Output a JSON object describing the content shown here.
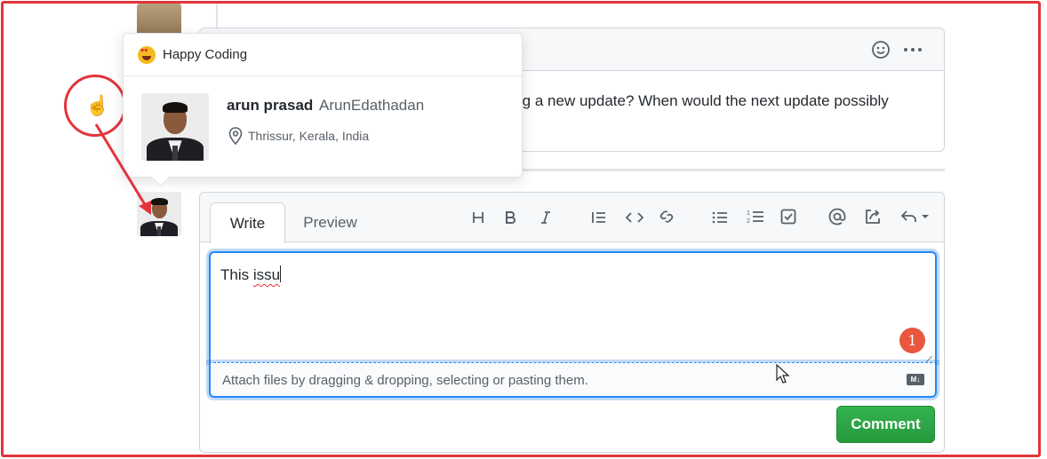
{
  "hovercard": {
    "status_emoji": "star-struck-emoji",
    "status_text": "Happy Coding",
    "name": "arun prasad",
    "login": "ArunEdathadan",
    "location": "Thrissur, Kerala, India"
  },
  "existing_comment": {
    "body_visible": "ding a new update? When would the next update possibly"
  },
  "editor": {
    "tabs": [
      "Write",
      "Preview"
    ],
    "active_tab": "Write",
    "toolbar": [
      "heading-icon",
      "bold-icon",
      "italic-icon",
      "quote-icon",
      "code-icon",
      "link-icon",
      "bulleted-list-icon",
      "numbered-list-icon",
      "task-list-icon",
      "mention-icon",
      "reference-icon",
      "saved-replies-icon"
    ],
    "text_prefix": "This ",
    "text_misspelled": "issu",
    "attach_hint": "Attach files by dragging & dropping, selecting or pasting them.",
    "markdown_badge": "M↓",
    "submit_label": "Comment"
  },
  "annotation": {
    "step_number": "1"
  },
  "colors": {
    "annotation_red": "#e2343b",
    "step_badge": "#e9573f",
    "submit_green": "#2ea44f",
    "focus_blue": "#2188ff"
  }
}
